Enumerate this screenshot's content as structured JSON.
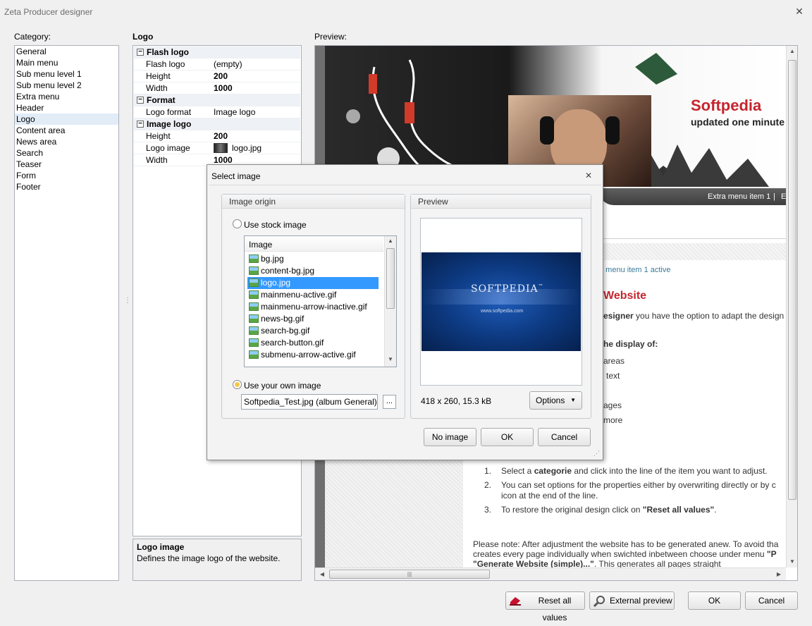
{
  "window": {
    "title": "Zeta Producer designer",
    "close": "✕"
  },
  "category": {
    "label": "Category:",
    "items": [
      "General",
      "Main menu",
      "Sub menu level 1",
      "Sub menu level 2",
      "Extra menu",
      "Header",
      "Logo",
      "Content area",
      "News area",
      "Search",
      "Teaser",
      "Form",
      "Footer"
    ],
    "selected": "Logo"
  },
  "props": {
    "title": "Logo",
    "groups": [
      {
        "name": "Flash logo",
        "rows": [
          {
            "n": "Flash logo",
            "v": "(empty)",
            "b": false
          },
          {
            "n": "Height",
            "v": "200",
            "b": true
          },
          {
            "n": "Width",
            "v": "1000",
            "b": true
          }
        ]
      },
      {
        "name": "Format",
        "rows": [
          {
            "n": "Logo format",
            "v": "Image logo",
            "b": false
          }
        ]
      },
      {
        "name": "Image logo",
        "rows": [
          {
            "n": "Height",
            "v": "200",
            "b": true
          },
          {
            "n": "Logo image",
            "v": "logo.jpg",
            "b": false
          },
          {
            "n": "Width",
            "v": "1000",
            "b": true
          }
        ]
      }
    ],
    "desc_title": "Logo image",
    "desc_text": "Defines the image logo of the website."
  },
  "preview": {
    "label": "Preview:",
    "brand": "Softpedia",
    "tagline": "updated one minute",
    "extra_menu": "Extra menu item 1",
    "sep": "|",
    "extra_e": "E",
    "sub_active": "o menu item 1 active",
    "heading": "Website",
    "p1_bold": "esigner",
    "p1_rest": " you have the option to adapt the design",
    "p2": "he display of:",
    "bullets": [
      "areas",
      "text",
      "ages",
      "more"
    ],
    "steps": [
      {
        "num": "1.",
        "pre": "Select a ",
        "b": "categorie",
        "post": " and click into the line of the item you want to adjust."
      },
      {
        "num": "2.",
        "pre": "You can set options for the properties either by overwriting directly or by c",
        "b": "",
        "post": ""
      },
      {
        "num": "",
        "pre": "icon at the end of the line.",
        "b": "",
        "post": ""
      },
      {
        "num": "3.",
        "pre": "To restore the original design click on ",
        "b": "\"Reset all values\"",
        "post": "."
      }
    ],
    "note1": "Please note: After adjustment the website has to be generated anew. To avoid tha",
    "note2": "creates every page individually when swichted inbetween choose under menu ",
    "note2_b": "\"P",
    "note3_b": "\"Generate Website (simple)...\"",
    "note3": ". This generates all pages straight"
  },
  "dialog": {
    "title": "Select image",
    "close": "✕",
    "origin_label": "Image origin",
    "stock_label": "Use stock image",
    "list_header": "Image",
    "files": [
      "bg.jpg",
      "content-bg.jpg",
      "logo.jpg",
      "mainmenu-active.gif",
      "mainmenu-arrow-inactive.gif",
      "news-bg.gif",
      "search-bg.gif",
      "search-button.gif",
      "submenu-arrow-active.gif"
    ],
    "selected_file": "logo.jpg",
    "own_label": "Use your own image",
    "own_value": "Softpedia_Test.jpg (album General)",
    "browse": "...",
    "preview_label": "Preview",
    "preview_brand": "SOFTPEDIA",
    "preview_tm": "™",
    "preview_url": "www.softpedia.com",
    "size_info": "418 x 260, 15.3 kB",
    "options": "Options",
    "no_image": "No image",
    "ok": "OK",
    "cancel": "Cancel"
  },
  "footer": {
    "reset": "Reset all values",
    "external": "External preview",
    "ok": "OK",
    "cancel": "Cancel"
  }
}
